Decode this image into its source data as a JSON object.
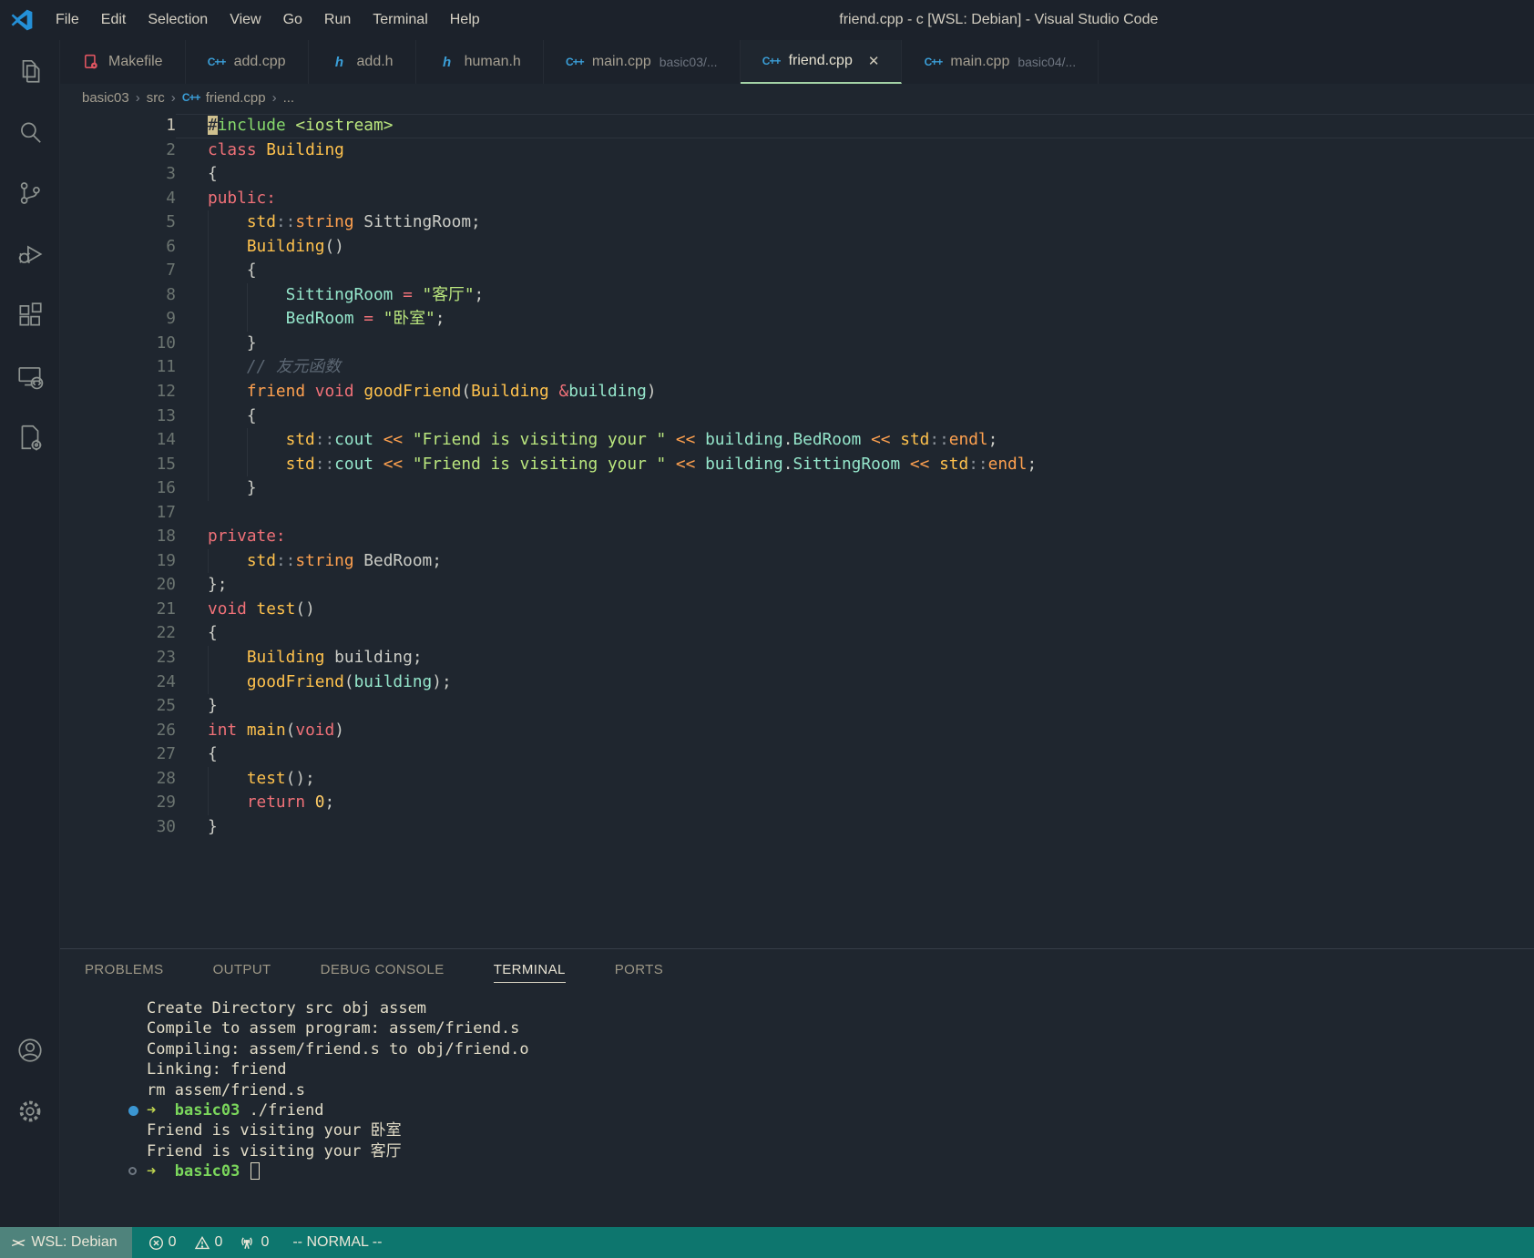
{
  "window": {
    "title": "friend.cpp - c [WSL: Debian] - Visual Studio Code",
    "menus": [
      "File",
      "Edit",
      "Selection",
      "View",
      "Go",
      "Run",
      "Terminal",
      "Help"
    ]
  },
  "activity_bar": {
    "top_items": [
      "explorer",
      "search",
      "source-control",
      "run-and-debug",
      "extensions",
      "remote-explorer",
      "cpp-tools"
    ],
    "bottom_items": [
      "accounts",
      "manage-settings"
    ]
  },
  "tabs": [
    {
      "label": "Makefile",
      "icon": "makefile",
      "hint": "",
      "active": false
    },
    {
      "label": "add.cpp",
      "icon": "cpp",
      "hint": "",
      "active": false
    },
    {
      "label": "add.h",
      "icon": "h",
      "hint": "",
      "active": false
    },
    {
      "label": "human.h",
      "icon": "h",
      "hint": "",
      "active": false
    },
    {
      "label": "main.cpp",
      "icon": "cpp",
      "hint": "basic03/...",
      "active": false
    },
    {
      "label": "friend.cpp",
      "icon": "cpp",
      "hint": "",
      "active": true,
      "close_label": "✕"
    },
    {
      "label": "main.cpp",
      "icon": "cpp",
      "hint": "basic04/...",
      "active": false
    }
  ],
  "breadcrumb": [
    {
      "label": "basic03",
      "icon": ""
    },
    {
      "label": "src",
      "icon": ""
    },
    {
      "label": "friend.cpp",
      "icon": "cpp"
    },
    {
      "label": "...",
      "icon": ""
    }
  ],
  "editor": {
    "cursor": {
      "line": 1,
      "on_char": "#",
      "vim_mode": "block"
    },
    "lines": [
      {
        "n": 1,
        "ind": 0,
        "t": [
          [
            "#",
            "cur"
          ],
          [
            "include",
            "grn"
          ],
          [
            " ",
            "pln"
          ],
          [
            "<iostream>",
            "str"
          ]
        ]
      },
      {
        "n": 2,
        "ind": 0,
        "t": [
          [
            "class",
            "red"
          ],
          [
            " ",
            "pln"
          ],
          [
            "Building",
            "gold"
          ]
        ]
      },
      {
        "n": 3,
        "ind": 0,
        "t": [
          [
            "{",
            "pln"
          ]
        ]
      },
      {
        "n": 4,
        "ind": 0,
        "t": [
          [
            "public:",
            "red"
          ]
        ]
      },
      {
        "n": 5,
        "ind": 1,
        "t": [
          [
            "std",
            "gold"
          ],
          [
            "::",
            "dim"
          ],
          [
            "string",
            "orn"
          ],
          [
            " SittingRoom;",
            "pln"
          ]
        ]
      },
      {
        "n": 6,
        "ind": 1,
        "t": [
          [
            "Building",
            "gold"
          ],
          [
            "()",
            "pln"
          ]
        ]
      },
      {
        "n": 7,
        "ind": 1,
        "t": [
          [
            "{",
            "pln"
          ]
        ]
      },
      {
        "n": 8,
        "ind": 2,
        "t": [
          [
            "SittingRoom",
            "teal"
          ],
          [
            " ",
            "pln"
          ],
          [
            "=",
            "red"
          ],
          [
            " ",
            "pln"
          ],
          [
            "\"客厅\"",
            "str"
          ],
          [
            ";",
            "pln"
          ]
        ]
      },
      {
        "n": 9,
        "ind": 2,
        "t": [
          [
            "BedRoom",
            "teal"
          ],
          [
            " ",
            "pln"
          ],
          [
            "=",
            "red"
          ],
          [
            " ",
            "pln"
          ],
          [
            "\"卧室\"",
            "str"
          ],
          [
            ";",
            "pln"
          ]
        ]
      },
      {
        "n": 10,
        "ind": 1,
        "t": [
          [
            "}",
            "pln"
          ]
        ]
      },
      {
        "n": 11,
        "ind": 1,
        "t": [
          [
            "// 友元函数",
            "cmt"
          ]
        ]
      },
      {
        "n": 12,
        "ind": 1,
        "t": [
          [
            "friend",
            "orn"
          ],
          [
            " ",
            "pln"
          ],
          [
            "void",
            "red"
          ],
          [
            " ",
            "pln"
          ],
          [
            "goodFriend",
            "gold"
          ],
          [
            "(",
            "pln"
          ],
          [
            "Building",
            "gold"
          ],
          [
            " ",
            "pln"
          ],
          [
            "&",
            "red"
          ],
          [
            "building",
            "teal"
          ],
          [
            ")",
            "pln"
          ]
        ]
      },
      {
        "n": 13,
        "ind": 1,
        "t": [
          [
            "{",
            "pln"
          ]
        ]
      },
      {
        "n": 14,
        "ind": 2,
        "t": [
          [
            "std",
            "gold"
          ],
          [
            "::",
            "dim"
          ],
          [
            "cout",
            "teal"
          ],
          [
            " ",
            "pln"
          ],
          [
            "<<",
            "orn"
          ],
          [
            " ",
            "pln"
          ],
          [
            "\"Friend is visiting your \"",
            "str"
          ],
          [
            " ",
            "pln"
          ],
          [
            "<<",
            "orn"
          ],
          [
            " ",
            "pln"
          ],
          [
            "building",
            "teal"
          ],
          [
            ".",
            "pln"
          ],
          [
            "BedRoom",
            "teal"
          ],
          [
            " ",
            "pln"
          ],
          [
            "<<",
            "orn"
          ],
          [
            " ",
            "pln"
          ],
          [
            "std",
            "gold"
          ],
          [
            "::",
            "dim"
          ],
          [
            "endl",
            "orn"
          ],
          [
            ";",
            "pln"
          ]
        ]
      },
      {
        "n": 15,
        "ind": 2,
        "t": [
          [
            "std",
            "gold"
          ],
          [
            "::",
            "dim"
          ],
          [
            "cout",
            "teal"
          ],
          [
            " ",
            "pln"
          ],
          [
            "<<",
            "orn"
          ],
          [
            " ",
            "pln"
          ],
          [
            "\"Friend is visiting your \"",
            "str"
          ],
          [
            " ",
            "pln"
          ],
          [
            "<<",
            "orn"
          ],
          [
            " ",
            "pln"
          ],
          [
            "building",
            "teal"
          ],
          [
            ".",
            "pln"
          ],
          [
            "SittingRoom",
            "teal"
          ],
          [
            " ",
            "pln"
          ],
          [
            "<<",
            "orn"
          ],
          [
            " ",
            "pln"
          ],
          [
            "std",
            "gold"
          ],
          [
            "::",
            "dim"
          ],
          [
            "endl",
            "orn"
          ],
          [
            ";",
            "pln"
          ]
        ]
      },
      {
        "n": 16,
        "ind": 1,
        "t": [
          [
            "}",
            "pln"
          ]
        ]
      },
      {
        "n": 17,
        "ind": 0,
        "t": []
      },
      {
        "n": 18,
        "ind": 0,
        "t": [
          [
            "private:",
            "red"
          ]
        ]
      },
      {
        "n": 19,
        "ind": 1,
        "t": [
          [
            "std",
            "gold"
          ],
          [
            "::",
            "dim"
          ],
          [
            "string",
            "orn"
          ],
          [
            " BedRoom;",
            "pln"
          ]
        ]
      },
      {
        "n": 20,
        "ind": 0,
        "t": [
          [
            "};",
            "pln"
          ]
        ]
      },
      {
        "n": 21,
        "ind": 0,
        "t": [
          [
            "void",
            "red"
          ],
          [
            " ",
            "pln"
          ],
          [
            "test",
            "gold"
          ],
          [
            "()",
            "pln"
          ]
        ]
      },
      {
        "n": 22,
        "ind": 0,
        "t": [
          [
            "{",
            "pln"
          ]
        ]
      },
      {
        "n": 23,
        "ind": 1,
        "t": [
          [
            "Building",
            "gold"
          ],
          [
            " building;",
            "pln"
          ]
        ]
      },
      {
        "n": 24,
        "ind": 1,
        "t": [
          [
            "goodFriend",
            "gold"
          ],
          [
            "(",
            "pln"
          ],
          [
            "building",
            "teal"
          ],
          [
            ");",
            "pln"
          ]
        ]
      },
      {
        "n": 25,
        "ind": 0,
        "t": [
          [
            "}",
            "pln"
          ]
        ]
      },
      {
        "n": 26,
        "ind": 0,
        "t": [
          [
            "int",
            "red"
          ],
          [
            " ",
            "pln"
          ],
          [
            "main",
            "gold"
          ],
          [
            "(",
            "pln"
          ],
          [
            "void",
            "red"
          ],
          [
            ")",
            "pln"
          ]
        ]
      },
      {
        "n": 27,
        "ind": 0,
        "t": [
          [
            "{",
            "pln"
          ]
        ]
      },
      {
        "n": 28,
        "ind": 1,
        "t": [
          [
            "test",
            "gold"
          ],
          [
            "();",
            "pln"
          ]
        ]
      },
      {
        "n": 29,
        "ind": 1,
        "t": [
          [
            "return",
            "red"
          ],
          [
            " ",
            "pln"
          ],
          [
            "0",
            "num"
          ],
          [
            ";",
            "pln"
          ]
        ]
      },
      {
        "n": 30,
        "ind": 0,
        "t": [
          [
            "}",
            "pln"
          ]
        ]
      }
    ]
  },
  "panel": {
    "tabs": [
      {
        "label": "PROBLEMS",
        "active": false
      },
      {
        "label": "OUTPUT",
        "active": false
      },
      {
        "label": "DEBUG CONSOLE",
        "active": false
      },
      {
        "label": "TERMINAL",
        "active": true
      },
      {
        "label": "PORTS",
        "active": false
      }
    ]
  },
  "terminal": {
    "lines": [
      {
        "dec": null,
        "cursor": false,
        "s": [
          [
            "Create Directory src obj assem",
            "pln"
          ]
        ]
      },
      {
        "dec": null,
        "cursor": false,
        "s": [
          [
            "Compile to assem program: assem/friend.s",
            "pln"
          ]
        ]
      },
      {
        "dec": null,
        "cursor": false,
        "s": [
          [
            "Compiling: assem/friend.s to obj/friend.o",
            "pln"
          ]
        ]
      },
      {
        "dec": null,
        "cursor": false,
        "s": [
          [
            "Linking: friend",
            "pln"
          ]
        ]
      },
      {
        "dec": null,
        "cursor": false,
        "s": [
          [
            "rm assem/friend.s",
            "pln"
          ]
        ]
      },
      {
        "dec": "blue",
        "cursor": false,
        "s": [
          [
            "➜",
            "arrow"
          ],
          [
            "  ",
            "pln"
          ],
          [
            "basic03",
            "grn"
          ],
          [
            " ./friend",
            "pln"
          ]
        ]
      },
      {
        "dec": null,
        "cursor": false,
        "s": [
          [
            "Friend is visiting your 卧室",
            "pln"
          ]
        ]
      },
      {
        "dec": null,
        "cursor": false,
        "s": [
          [
            "Friend is visiting your 客厅",
            "pln"
          ]
        ]
      },
      {
        "dec": "hollow",
        "cursor": true,
        "s": [
          [
            "➜",
            "arrow"
          ],
          [
            "  ",
            "pln"
          ],
          [
            "basic03",
            "grn"
          ],
          [
            " ",
            "pln"
          ]
        ]
      }
    ]
  },
  "status_bar": {
    "remote": {
      "label": "WSL: Debian",
      "icon": "remote-indicator"
    },
    "errors": "0",
    "warnings": "0",
    "ports": "0",
    "mode": "-- NORMAL --"
  },
  "colors": {
    "statusbar": "#0d766e",
    "remote_badge": "#4f837c",
    "tab_underline": "#a3d1a5",
    "cursor": "#cfc08e",
    "dec_blue": "#3b96d2",
    "term_green": "#7bd75c",
    "term_arrow": "#bdd24f",
    "tokens": {
      "red": "#f07178",
      "orn": "#ffa14f",
      "gold": "#ffc24d",
      "teal": "#95e6cb",
      "pln": "#cbccc6",
      "str": "#bae67e",
      "grn": "#87d96c",
      "cmt": "#5c6773",
      "dim": "#8a9199",
      "num": "#ffcc66"
    }
  }
}
